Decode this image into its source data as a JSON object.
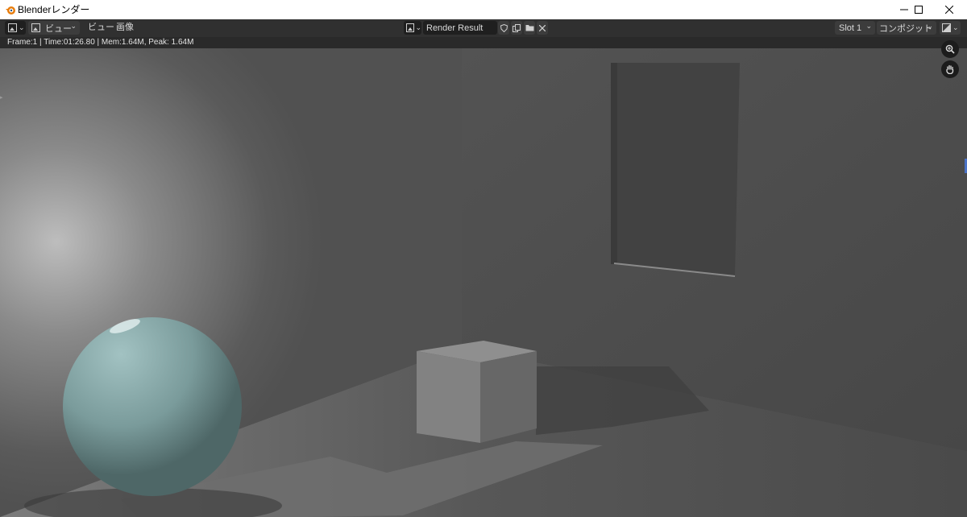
{
  "window": {
    "title": "Blenderレンダー",
    "minimize_icon": "minimize-icon",
    "maximize_icon": "maximize-icon",
    "close_icon": "close-icon"
  },
  "header": {
    "editor_type_icon": "image-editor-icon",
    "mode_label": "ビュー",
    "menus": [
      "ビュー",
      "画像"
    ],
    "image_name": "Render Result",
    "slot": "Slot 1",
    "layer": "コンポジット",
    "icons": [
      "shield-icon",
      "duplicate-icon",
      "folder-icon",
      "close-icon",
      "display-channels-icon"
    ]
  },
  "info": {
    "text": "Frame:1 | Time:01:26.80 | Mem:1.64M, Peak: 1.64M"
  },
  "viewport": {
    "navigation": [
      "zoom-icon",
      "hand-icon"
    ],
    "colors": {
      "wall_left": "#5a5a5a",
      "wall_back": "#4e4e4e",
      "floor": "#585858",
      "sphere": "#7fa0a0",
      "cube": "#7a7a7a"
    }
  }
}
